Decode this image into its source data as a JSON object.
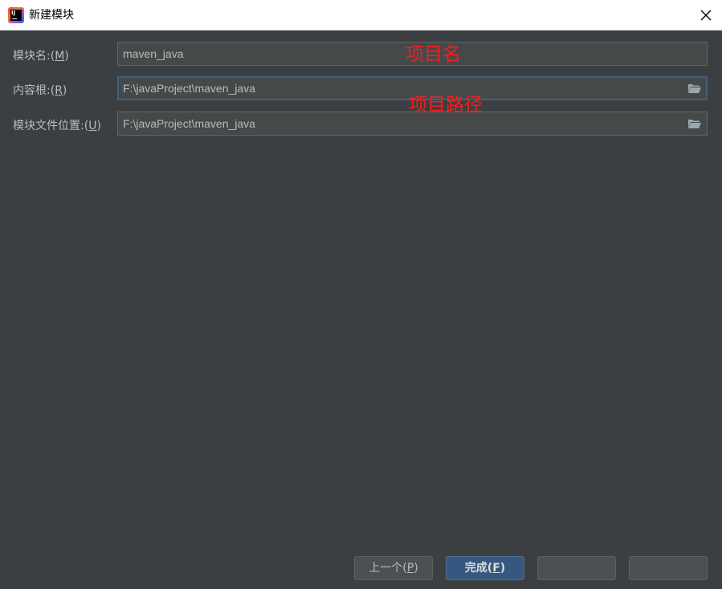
{
  "window": {
    "title": "新建模块",
    "close_icon": "close-icon"
  },
  "form": {
    "module_name": {
      "label": "模块名:",
      "mnemonic_open": "(",
      "mnemonic": "M",
      "mnemonic_close": ")",
      "value": "maven_java"
    },
    "content_root": {
      "label": "内容根:",
      "mnemonic_open": "(",
      "mnemonic": "R",
      "mnemonic_close": ")",
      "value": "F:\\javaProject\\maven_java"
    },
    "module_file_location": {
      "label": "模块文件位置:",
      "mnemonic_open": "(",
      "mnemonic": "U",
      "mnemonic_close": ")",
      "value": "F:\\javaProject\\maven_java"
    }
  },
  "annotations": {
    "project_name": "项目名",
    "project_path": "项目路径"
  },
  "buttons": {
    "previous": {
      "label": "上一个",
      "mnemonic_open": "(",
      "mnemonic": "P",
      "mnemonic_close": ")"
    },
    "finish": {
      "label": "完成",
      "mnemonic_open": "(",
      "mnemonic": "F",
      "mnemonic_close": ")"
    }
  },
  "colors": {
    "background": "#3c3f41",
    "field_bg": "#45494a",
    "focus_border": "#3d6185",
    "primary_button": "#365880",
    "annotation_red": "#ff1a1a"
  }
}
